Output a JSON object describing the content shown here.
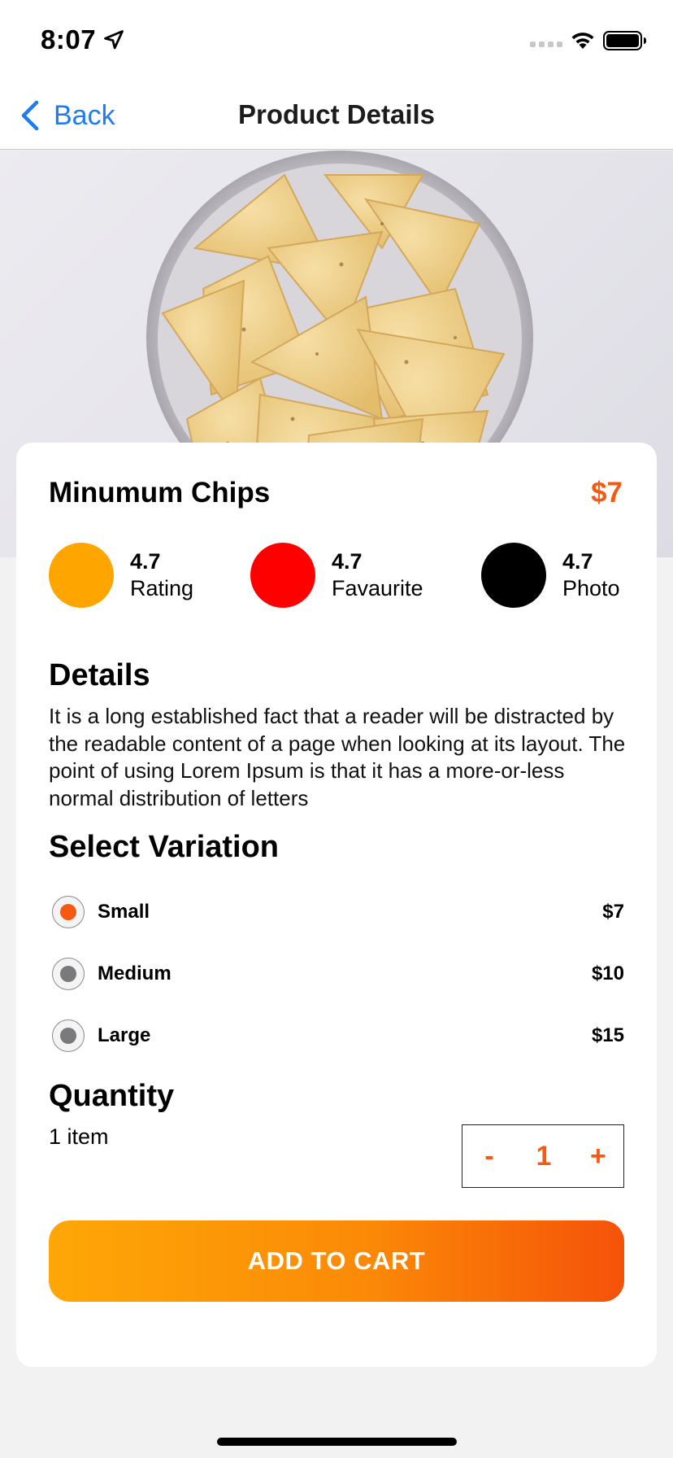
{
  "status_bar": {
    "time": "8:07",
    "icons": [
      "location-arrow-icon",
      "cellular-signal-icon",
      "wifi-icon",
      "battery-icon"
    ]
  },
  "nav": {
    "back_label": "Back",
    "title": "Product Details"
  },
  "product": {
    "name": "Minumum Chips",
    "price": "$7",
    "image": "tortilla-chips-bowl"
  },
  "stats": [
    {
      "value": "4.7",
      "label": "Rating",
      "color": "#FFA500"
    },
    {
      "value": "4.7",
      "label": "Favaurite",
      "color": "#FF0000"
    },
    {
      "value": "4.7",
      "label": "Photo",
      "color": "#000000"
    }
  ],
  "details": {
    "title": "Details",
    "text": "It is a long established fact that a reader will be distracted by the readable content of a page when looking at its layout. The point of using Lorem Ipsum is that it has a more-or-less normal distribution of letters"
  },
  "variation": {
    "title": "Select Variation",
    "options": [
      {
        "label": "Small",
        "price": "$7",
        "selected": true
      },
      {
        "label": "Medium",
        "price": "$10",
        "selected": false
      },
      {
        "label": "Large",
        "price": "$15",
        "selected": false
      }
    ]
  },
  "quantity": {
    "title": "Quantity",
    "subtitle": "1 item",
    "decrement_label": "-",
    "value": "1",
    "increment_label": "+"
  },
  "cta": {
    "add_to_cart_label": "ADD TO CART"
  },
  "colors": {
    "accent": "#F55A12",
    "link": "#1E7CF2",
    "gradient_start": "#FEA707",
    "gradient_end": "#F55209"
  }
}
